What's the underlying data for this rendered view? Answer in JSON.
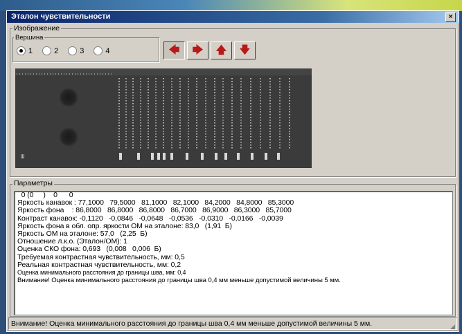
{
  "window": {
    "title": "Эталон чувствительности",
    "close_label": "×"
  },
  "image_group": {
    "label": "Изображение",
    "vertex_label": "Вершина",
    "radio_options": [
      "1",
      "2",
      "3",
      "4"
    ],
    "selected": "1",
    "buttons": [
      {
        "icon": "arrow-left-icon",
        "glyph": "🡄",
        "pressed": true
      },
      {
        "icon": "arrow-right-icon",
        "glyph": "🡆",
        "pressed": false
      },
      {
        "icon": "arrow-up-icon",
        "glyph": "🡅",
        "pressed": false
      },
      {
        "icon": "arrow-down-icon",
        "glyph": "🡇",
        "pressed": false
      }
    ]
  },
  "params_group": {
    "label": "Параметры",
    "lines": [
      "  0 (0     )    0      0",
      "Яркость канавок : 77,1000   79,5000   81,1000   82,1000   84,2000   84,8000   85,3000",
      "Яркость фона    : 86,8000   86,8000   86,8000   86,7000   86,9000   86,3000   85,7000",
      "Контраст канавок: -0,1120   -0,0846   -0,0648   -0,0536   -0,0310   -0,0166   -0,0039",
      "Яркость фона в обл. опр. яркости ОМ на эталоне: 83,0   (1,91  Б)",
      "Яркость ОМ на эталоне: 57,0   (2,25  Б)",
      "Отношение л.к.о. (Эталон/ОМ): 1",
      "Оценка СКО фона: 0,693   (0,008   0,006  Б)",
      "Требуемая контрастная чувствительность, мм: 0,5",
      "Реальная контрастная чувствительность, мм: 0,2",
      "Оценка минимального расстояния до границы шва, мм: 0,4",
      "Внимание! Оценка минимального расстояния до границы шва 0,4 мм меньше допустимой величины 5 мм."
    ]
  },
  "status": {
    "text": "Внимание! Оценка минимального расстояния до границы шва 0,4 мм меньше допустимой величины 5 мм."
  },
  "colors": {
    "titlebar": "#0a246a",
    "arrow": "#b81a1a",
    "panel": "#3a3a3a"
  }
}
